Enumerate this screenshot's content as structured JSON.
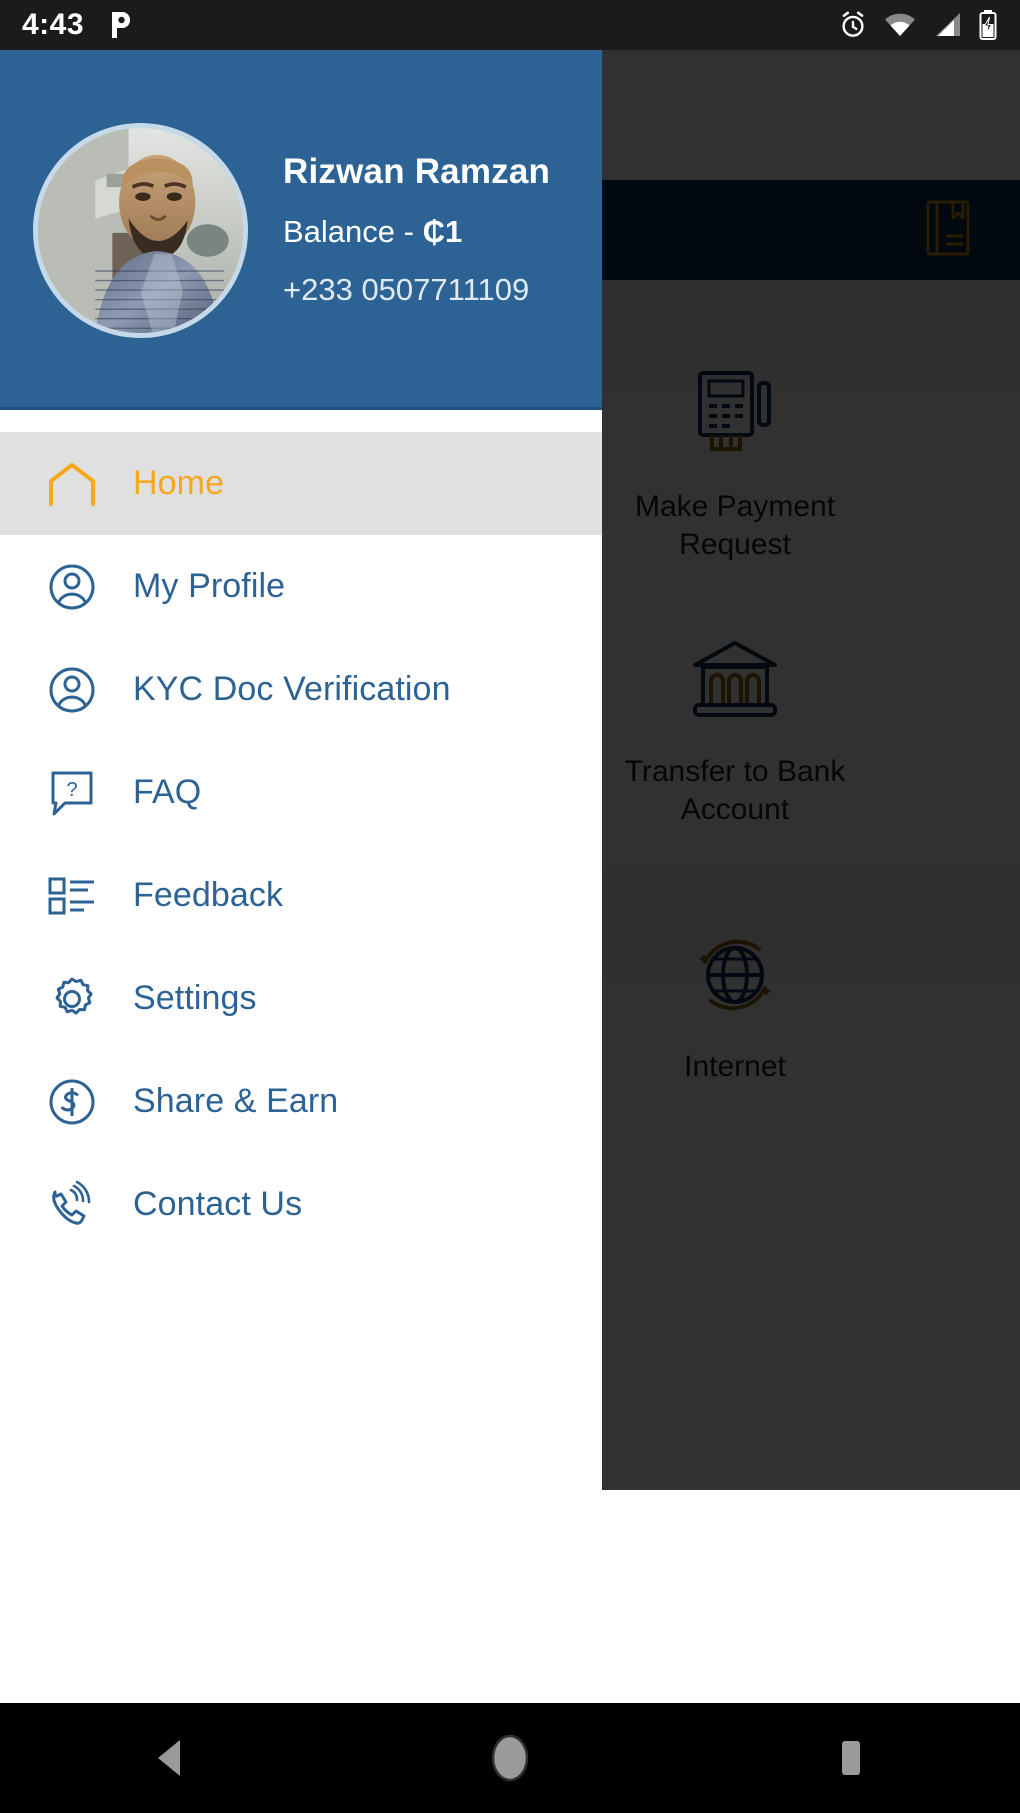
{
  "status_bar": {
    "time": "4:43",
    "notification_icons": [
      "pandora-p-icon"
    ],
    "system_icons": [
      "alarm-icon",
      "wifi-icon",
      "cellular-signal-icon",
      "battery-charging-icon"
    ]
  },
  "drawer": {
    "profile": {
      "name": "Rizwan Ramzan",
      "balance_label": "Balance - ",
      "balance_value": "₵1",
      "phone": "+233 0507711109",
      "avatar": "user-photo"
    },
    "menu": [
      {
        "label": "Home",
        "icon": "home-icon",
        "active": true
      },
      {
        "label": "My Profile",
        "icon": "user-circle-icon",
        "active": false
      },
      {
        "label": "KYC Doc Verification",
        "icon": "user-circle-icon",
        "active": false
      },
      {
        "label": "FAQ",
        "icon": "question-bubble-icon",
        "active": false
      },
      {
        "label": "Feedback",
        "icon": "feedback-list-icon",
        "active": false
      },
      {
        "label": "Settings",
        "icon": "gear-icon",
        "active": false
      },
      {
        "label": "Share & Earn",
        "icon": "dollar-circle-icon",
        "active": false
      },
      {
        "label": "Contact Us",
        "icon": "phone-ring-icon",
        "active": false
      }
    ]
  },
  "background_app": {
    "appbar_icon": "address-book-icon",
    "tiles": [
      {
        "label": "Make Payment Request",
        "icon": "pos-terminal-icon"
      },
      {
        "label": "Transfer to Bank Account",
        "icon": "bank-building-icon"
      },
      {
        "label": "Internet",
        "icon": "globe-refresh-icon"
      }
    ]
  },
  "nav_bar": {
    "back": "back-triangle-icon",
    "home": "home-circle-icon",
    "recents": "recents-square-icon"
  },
  "colors": {
    "header_blue": "#2d6394",
    "accent_orange": "#f5a81c",
    "active_row_gray": "#e0e0e0",
    "appbar_dark_navy": "#0d2b4d"
  }
}
